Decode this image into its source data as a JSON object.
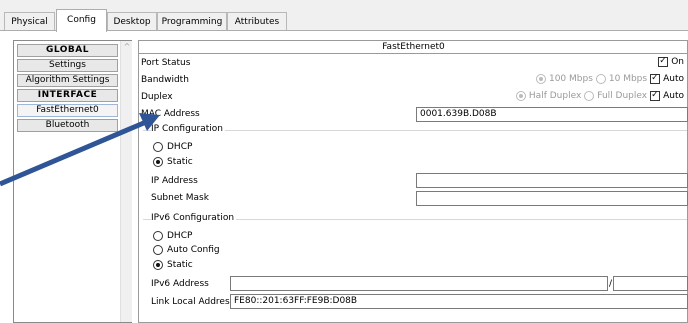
{
  "tabs": [
    "Physical",
    "Config",
    "Desktop",
    "Programming",
    "Attributes"
  ],
  "active_tab": "Config",
  "nav": {
    "items": [
      {
        "label": "GLOBAL",
        "header": true
      },
      {
        "label": "Settings",
        "header": false
      },
      {
        "label": "Algorithm Settings",
        "header": false
      },
      {
        "label": "INTERFACE",
        "header": true
      },
      {
        "label": "FastEthernet0",
        "header": false
      },
      {
        "label": "Bluetooth",
        "header": false
      }
    ]
  },
  "panel": {
    "title": "FastEthernet0",
    "port_status": {
      "label": "Port Status",
      "on_label": "On",
      "checked": true
    },
    "bandwidth": {
      "label": "Bandwidth",
      "opt1": "100 Mbps",
      "opt2": "10 Mbps",
      "auto": "Auto",
      "auto_checked": true
    },
    "duplex": {
      "label": "Duplex",
      "opt1": "Half Duplex",
      "opt2": "Full Duplex",
      "auto": "Auto",
      "auto_checked": true
    },
    "mac": {
      "label": "MAC Address",
      "value": "0001.639B.D08B"
    },
    "ip_config": {
      "title": "IP Configuration",
      "dhcp": "DHCP",
      "static": "Static",
      "selected": "Static",
      "ip_label": "IP Address",
      "ip_value": "",
      "mask_label": "Subnet Mask",
      "mask_value": ""
    },
    "ipv6_config": {
      "title": "IPv6 Configuration",
      "dhcp": "DHCP",
      "auto": "Auto Config",
      "static": "Static",
      "selected": "Static",
      "addr_label": "IPv6 Address",
      "addr_value": "",
      "prefix_sep": "/",
      "prefix_value": "",
      "link_local_label": "Link Local Address:",
      "link_local_value": "FE80::201:63FF:FE9B:D08B"
    }
  },
  "colors": {
    "arrow": "#2f5597",
    "border": "#9a9a9a",
    "disabled_text": "#9a9a9a"
  }
}
